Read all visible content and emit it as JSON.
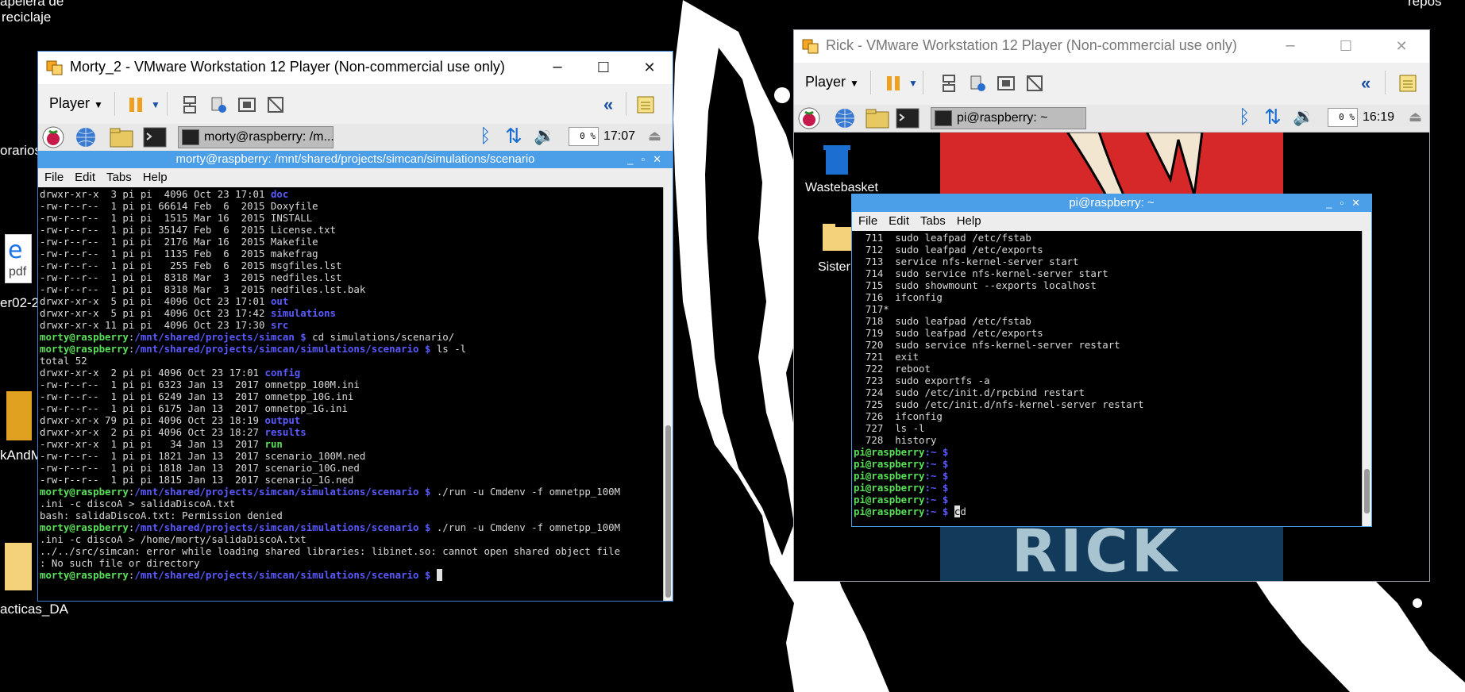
{
  "desktop": {
    "top_left_label_1": "apelera de",
    "top_left_label_2": "reciclaje",
    "top_right_label": "repos",
    "labels": [
      "orarios",
      "er02-2",
      "kAndM",
      "acticas_DA"
    ]
  },
  "morty_window": {
    "title": "Morty_2 - VMware Workstation 12 Player (Non-commercial use only)",
    "player_menu": "Player",
    "pi_panel": {
      "task_label": "morty@raspberry: /m...",
      "cpu": "0 %",
      "clock": "17:07"
    },
    "terminal": {
      "title": "morty@raspberry: /mnt/shared/projects/simcan/simulations/scenario",
      "menu": [
        "File",
        "Edit",
        "Tabs",
        "Help"
      ],
      "lines": [
        [
          [
            "drwxr-xr-x  3 pi pi  4096 Oct 23 17:01 ",
            ""
          ],
          [
            "doc",
            "bl"
          ]
        ],
        [
          [
            "-rw-r--r--  1 pi pi 66614 Feb  6  2015 Doxyfile",
            ""
          ]
        ],
        [
          [
            "-rw-r--r--  1 pi pi  1515 Mar 16  2015 INSTALL",
            ""
          ]
        ],
        [
          [
            "-rw-r--r--  1 pi pi 35147 Feb  6  2015 License.txt",
            ""
          ]
        ],
        [
          [
            "-rw-r--r--  1 pi pi  2176 Mar 16  2015 Makefile",
            ""
          ]
        ],
        [
          [
            "-rw-r--r--  1 pi pi  1135 Feb  6  2015 makefrag",
            ""
          ]
        ],
        [
          [
            "-rw-r--r--  1 pi pi   255 Feb  6  2015 msgfiles.lst",
            ""
          ]
        ],
        [
          [
            "-rw-r--r--  1 pi pi  8318 Mar  3  2015 nedfiles.lst",
            ""
          ]
        ],
        [
          [
            "-rw-r--r--  1 pi pi  8318 Mar  3  2015 nedfiles.lst.bak",
            ""
          ]
        ],
        [
          [
            "drwxr-xr-x  5 pi pi  4096 Oct 23 17:01 ",
            ""
          ],
          [
            "out",
            "bl"
          ]
        ],
        [
          [
            "drwxr-xr-x  5 pi pi  4096 Oct 23 17:42 ",
            ""
          ],
          [
            "simulations",
            "bl"
          ]
        ],
        [
          [
            "drwxr-xr-x 11 pi pi  4096 Oct 23 17:30 ",
            ""
          ],
          [
            "src",
            "bl"
          ]
        ],
        [
          [
            "morty@raspberry",
            "gr"
          ],
          [
            ":",
            ""
          ],
          [
            "/mnt/shared/projects/simcan $",
            "bb"
          ],
          [
            " cd simulations/scenario/",
            ""
          ]
        ],
        [
          [
            "morty@raspberry",
            "gr"
          ],
          [
            ":",
            ""
          ],
          [
            "/mnt/shared/projects/simcan/simulations/scenario $",
            "bb"
          ],
          [
            " ls -l",
            ""
          ]
        ],
        [
          [
            "total 52",
            ""
          ]
        ],
        [
          [
            "drwxr-xr-x  2 pi pi 4096 Oct 23 17:01 ",
            ""
          ],
          [
            "config",
            "bl"
          ]
        ],
        [
          [
            "-rw-r--r--  1 pi pi 6323 Jan 13  2017 omnetpp_100M.ini",
            ""
          ]
        ],
        [
          [
            "-rw-r--r--  1 pi pi 6249 Jan 13  2017 omnetpp_10G.ini",
            ""
          ]
        ],
        [
          [
            "-rw-r--r--  1 pi pi 6175 Jan 13  2017 omnetpp_1G.ini",
            ""
          ]
        ],
        [
          [
            "drwxr-xr-x 79 pi pi 4096 Oct 23 18:19 ",
            ""
          ],
          [
            "output",
            "bl"
          ]
        ],
        [
          [
            "drwxr-xr-x  2 pi pi 4096 Oct 23 18:27 ",
            ""
          ],
          [
            "results",
            "bl"
          ]
        ],
        [
          [
            "-rwxr-xr-x  1 pi pi   34 Jan 13  2017 ",
            ""
          ],
          [
            "run",
            "gr"
          ]
        ],
        [
          [
            "-rw-r--r--  1 pi pi 1821 Jan 13  2017 scenario_100M.ned",
            ""
          ]
        ],
        [
          [
            "-rw-r--r--  1 pi pi 1818 Jan 13  2017 scenario_10G.ned",
            ""
          ]
        ],
        [
          [
            "-rw-r--r--  1 pi pi 1815 Jan 13  2017 scenario_1G.ned",
            ""
          ]
        ],
        [
          [
            "morty@raspberry",
            "gr"
          ],
          [
            ":",
            ""
          ],
          [
            "/mnt/shared/projects/simcan/simulations/scenario $",
            "bb"
          ],
          [
            " ./run -u Cmdenv -f omnetpp_100M",
            ""
          ]
        ],
        [
          [
            ".ini -c discoA > salidaDiscoA.txt",
            ""
          ]
        ],
        [
          [
            "bash: salidaDiscoA.txt: Permission denied",
            ""
          ]
        ],
        [
          [
            "morty@raspberry",
            "gr"
          ],
          [
            ":",
            ""
          ],
          [
            "/mnt/shared/projects/simcan/simulations/scenario $",
            "bb"
          ],
          [
            " ./run -u Cmdenv -f omnetpp_100M",
            ""
          ]
        ],
        [
          [
            ".ini -c discoA > /home/morty/salidaDiscoA.txt",
            ""
          ]
        ],
        [
          [
            "../../src/simcan: error while loading shared libraries: libinet.so: cannot open shared object file",
            ""
          ]
        ],
        [
          [
            ": No such file or directory",
            ""
          ]
        ],
        [
          [
            "morty@raspberry",
            "gr"
          ],
          [
            ":",
            ""
          ],
          [
            "/mnt/shared/projects/simcan/simulations/scenario $",
            "bb"
          ],
          [
            " ",
            ""
          ],
          [
            " ",
            "cursor"
          ]
        ]
      ]
    }
  },
  "rick_window": {
    "title": "Rick - VMware Workstation 12 Player (Non-commercial use only)",
    "player_menu": "Player",
    "pi_panel": {
      "task_label": "pi@raspberry: ~",
      "cpu": "0 %",
      "clock": "16:19"
    },
    "desktop_icons": [
      "Wastebasket",
      "Sister"
    ],
    "wallpaper_text": "RICK",
    "terminal": {
      "title": "pi@raspberry: ~",
      "menu": [
        "File",
        "Edit",
        "Tabs",
        "Help"
      ],
      "lines": [
        [
          [
            "  711  sudo leafpad /etc/fstab",
            ""
          ]
        ],
        [
          [
            "  712  sudo leafpad /etc/exports",
            ""
          ]
        ],
        [
          [
            "  713  service nfs-kernel-server start",
            ""
          ]
        ],
        [
          [
            "  714  sudo service nfs-kernel-server start",
            ""
          ]
        ],
        [
          [
            "  715  sudo showmount --exports localhost",
            ""
          ]
        ],
        [
          [
            "  716  ifconfig",
            ""
          ]
        ],
        [
          [
            "  717*",
            ""
          ]
        ],
        [
          [
            "  718  sudo leafpad /etc/fstab",
            ""
          ]
        ],
        [
          [
            "  719  sudo leafpad /etc/exports",
            ""
          ]
        ],
        [
          [
            "  720  sudo service nfs-kernel-server restart",
            ""
          ]
        ],
        [
          [
            "  721  exit",
            ""
          ]
        ],
        [
          [
            "  722  reboot",
            ""
          ]
        ],
        [
          [
            "  723  sudo exportfs -a",
            ""
          ]
        ],
        [
          [
            "  724  sudo /etc/init.d/rpcbind restart",
            ""
          ]
        ],
        [
          [
            "  725  sudo /etc/init.d/nfs-kernel-server restart",
            ""
          ]
        ],
        [
          [
            "  726  ifconfig",
            ""
          ]
        ],
        [
          [
            "  727  ls -l",
            ""
          ]
        ],
        [
          [
            "  728  history",
            ""
          ]
        ],
        [
          [
            "pi@raspberry",
            "gr"
          ],
          [
            ":~ ",
            "bb"
          ],
          [
            "$",
            "bb"
          ]
        ],
        [
          [
            "pi@raspberry",
            "gr"
          ],
          [
            ":~ ",
            "bb"
          ],
          [
            "$",
            "bb"
          ]
        ],
        [
          [
            "pi@raspberry",
            "gr"
          ],
          [
            ":~ ",
            "bb"
          ],
          [
            "$",
            "bb"
          ]
        ],
        [
          [
            "pi@raspberry",
            "gr"
          ],
          [
            ":~ ",
            "bb"
          ],
          [
            "$",
            "bb"
          ]
        ],
        [
          [
            "pi@raspberry",
            "gr"
          ],
          [
            ":~ ",
            "bb"
          ],
          [
            "$",
            "bb"
          ]
        ],
        [
          [
            "pi@raspberry",
            "gr"
          ],
          [
            ":~ ",
            "bb"
          ],
          [
            "$ ",
            "bb"
          ],
          [
            "c",
            "cursor"
          ],
          [
            "d",
            ""
          ]
        ]
      ]
    }
  }
}
